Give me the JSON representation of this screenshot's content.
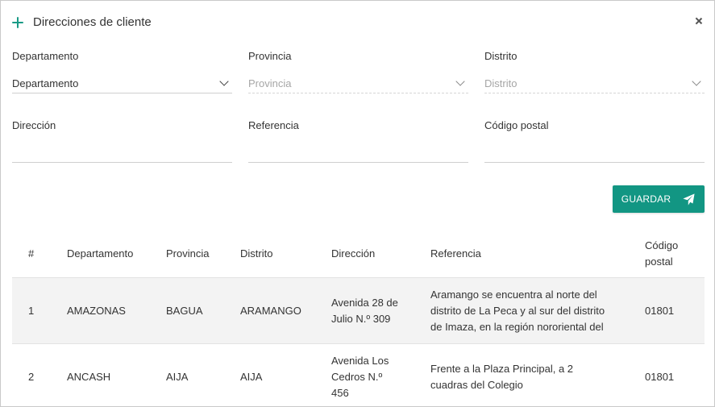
{
  "dialog": {
    "title": "Direcciones de cliente"
  },
  "form": {
    "departamento_label": "Departamento",
    "departamento_value": "Departamento",
    "provincia_label": "Provincia",
    "provincia_value": "Provincia",
    "distrito_label": "Distrito",
    "distrito_value": "Distrito",
    "direccion_label": "Dirección",
    "direccion_value": "",
    "referencia_label": "Referencia",
    "referencia_value": "",
    "codigo_postal_label": "Código postal",
    "codigo_postal_value": ""
  },
  "actions": {
    "save_label": "GUARDAR"
  },
  "table": {
    "headers": [
      "#",
      "Departamento",
      "Provincia",
      "Distrito",
      "Dirección",
      "Referencia",
      "Código postal"
    ],
    "rows": [
      {
        "num": "1",
        "departamento": "AMAZONAS",
        "provincia": "BAGUA",
        "distrito": "ARAMANGO",
        "direccion": "Avenida 28 de Julio N.º 309",
        "referencia": "Aramango se encuentra al norte del distrito de La Peca y al sur del distrito de Imaza, en la región nororiental del",
        "codigo_postal": "01801"
      },
      {
        "num": "2",
        "departamento": "ANCASH",
        "provincia": "AIJA",
        "distrito": "AIJA",
        "direccion": "Avenida Los Cedros N.º 456",
        "referencia": "Frente a la Plaza Principal, a 2 cuadras del Colegio",
        "codigo_postal": "01801"
      }
    ]
  },
  "colors": {
    "accent": "#129683",
    "row_highlight": "#f3f3f3"
  },
  "icons": {
    "add": "plus-icon",
    "close": "close-icon",
    "dropdown": "chevron-down-icon",
    "send": "send-icon"
  }
}
